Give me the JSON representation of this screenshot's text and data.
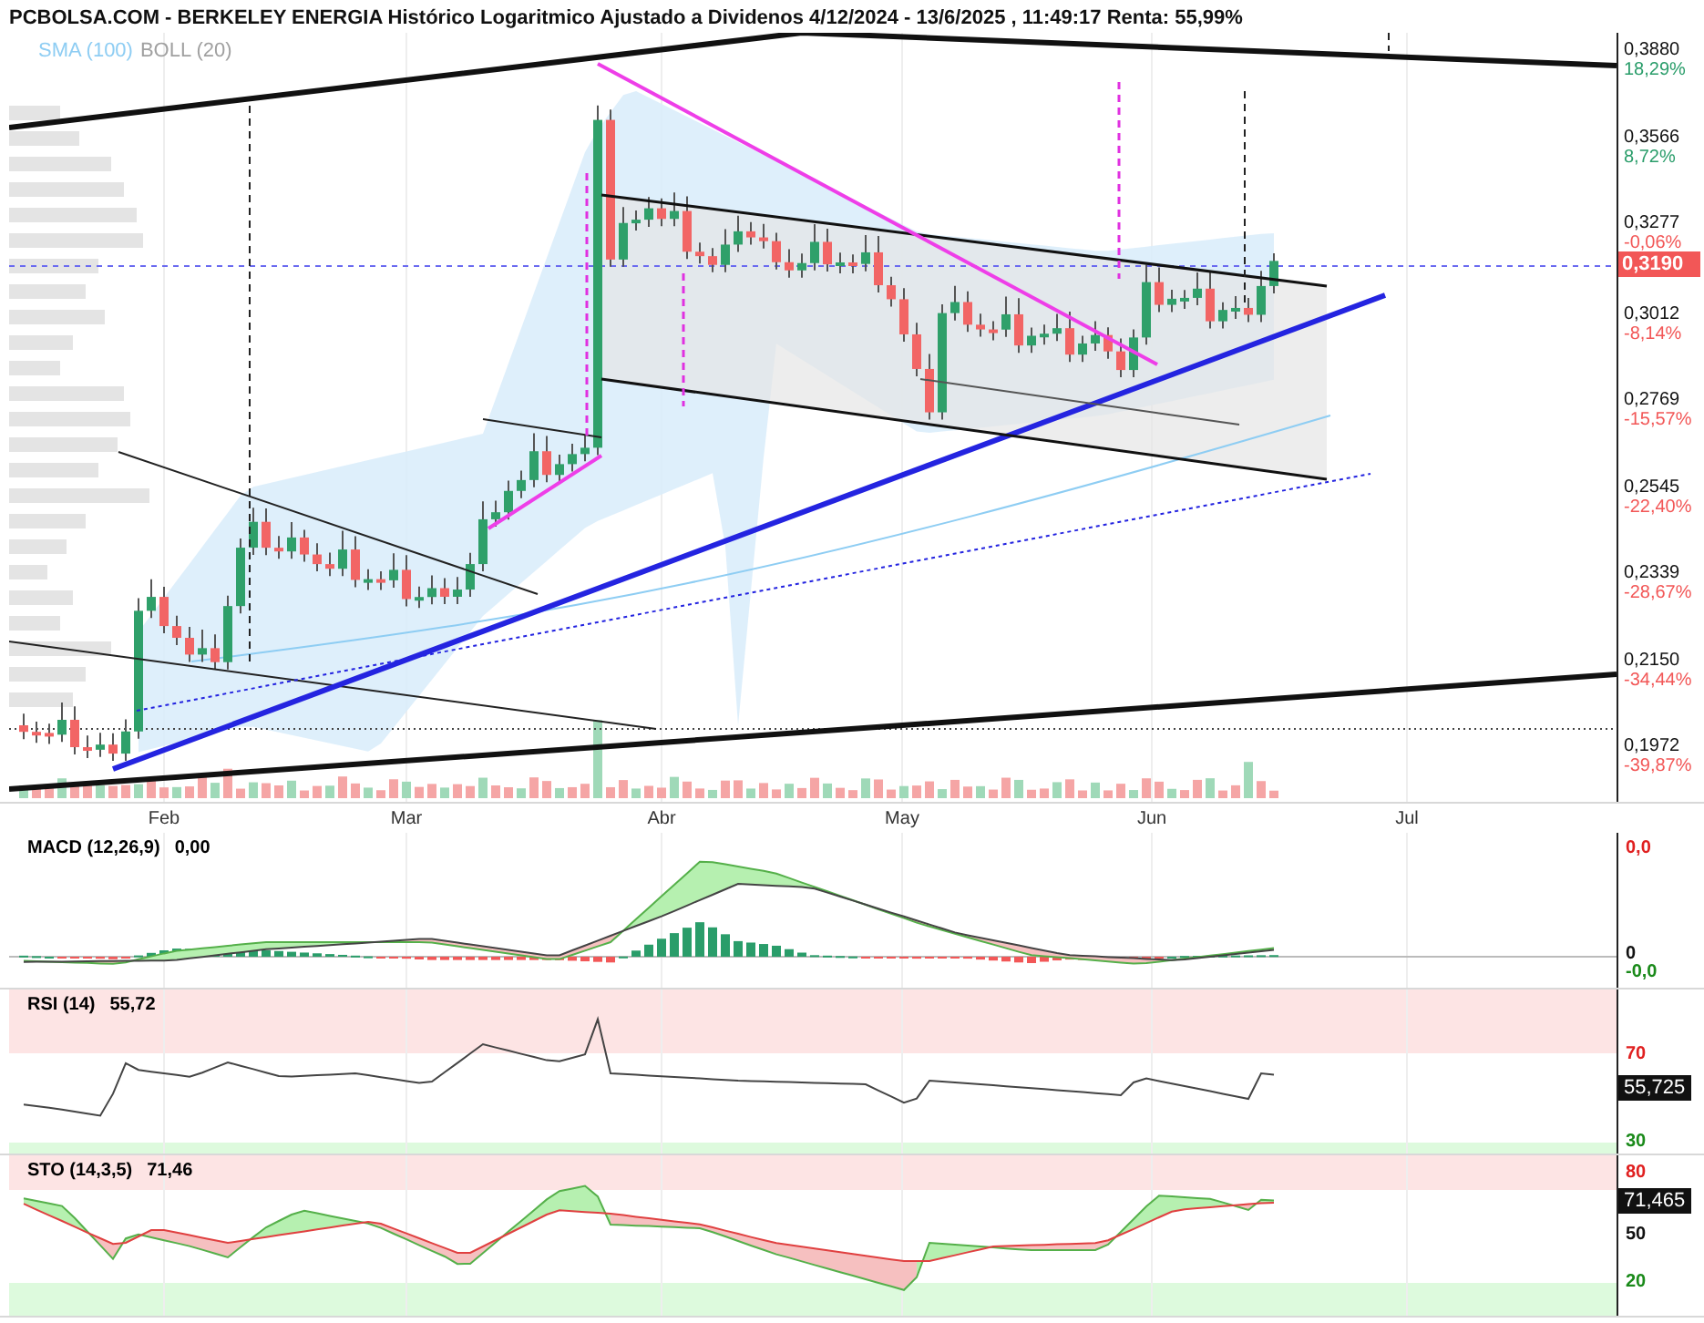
{
  "title": "PCBOLSA.COM - BERKELEY ENERGIA Histórico Logaritmico Ajustado a Dividenos 4/12/2024 - 13/6/2025 , 11:49:17 Renta: 55,99%",
  "legend": [
    {
      "label": "SMA (100)",
      "color": "#8ecdf3"
    },
    {
      "label": "BOLL (20)",
      "color": "#a0a0a0"
    }
  ],
  "price_axis": [
    {
      "price": "0,3880",
      "change": "18,29%",
      "color": "#2a9d6a"
    },
    {
      "price": "0,3566",
      "change": "8,72%",
      "color": "#2a9d6a"
    },
    {
      "price": "0,3277",
      "change": "-0,06%",
      "color": "#f25757"
    },
    {
      "price": "0,3012",
      "change": "-8,14%",
      "color": "#f25757"
    },
    {
      "price": "0,2769",
      "change": "-15,57%",
      "color": "#f25757"
    },
    {
      "price": "0,2545",
      "change": "-22,40%",
      "color": "#f25757"
    },
    {
      "price": "0,2339",
      "change": "-28,67%",
      "color": "#f25757"
    },
    {
      "price": "0,2150",
      "change": "-34,44%",
      "color": "#f25757"
    },
    {
      "price": "0,1972",
      "change": "-39,87%",
      "color": "#f25757"
    }
  ],
  "current_price": "0,3190",
  "months": [
    "Feb",
    "Mar",
    "Abr",
    "May",
    "Jun",
    "Jul"
  ],
  "macd": {
    "label": "MACD (12,26,9)",
    "value": "0,00",
    "axis": [
      {
        "text": "0,0",
        "color": "#e02020"
      },
      {
        "text": "0",
        "color": "#111111"
      },
      {
        "text": "-0,0",
        "color": "#1a8a1a"
      }
    ]
  },
  "rsi": {
    "label": "RSI (14)",
    "value": "55,72",
    "current": "55,725",
    "axis": [
      {
        "text": "70",
        "color": "#e02020"
      },
      {
        "text": "30",
        "color": "#1a8a1a"
      }
    ]
  },
  "sto": {
    "label": "STO (14,3,5)",
    "value": "71,46",
    "current": "71,465",
    "axis": [
      {
        "text": "80",
        "color": "#e02020"
      },
      {
        "text": "50",
        "color": "#111111"
      },
      {
        "text": "20",
        "color": "#1a8a1a"
      }
    ]
  }
}
